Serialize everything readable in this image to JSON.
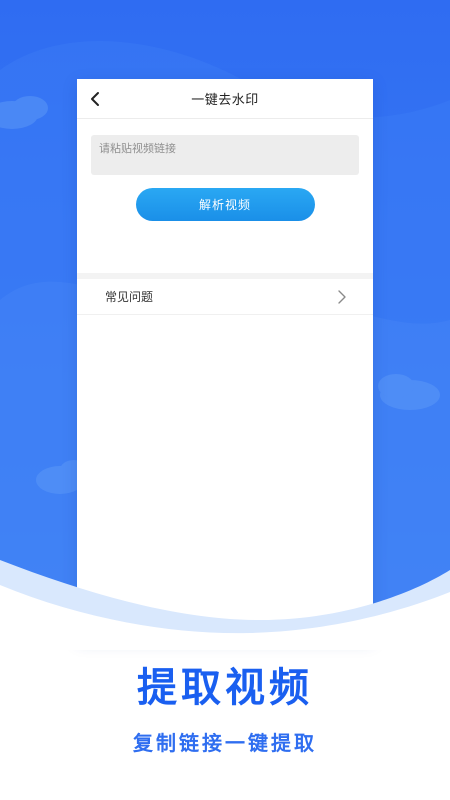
{
  "nav": {
    "back_icon": "chevron-left-icon",
    "title": "一键去水印"
  },
  "form": {
    "link_input_value": "",
    "link_input_placeholder": "请粘贴视频链接",
    "parse_button_label": "解析视频"
  },
  "faq": {
    "label": "常见问题",
    "chevron_icon": "chevron-right-icon"
  },
  "promo": {
    "headline": "提取视频",
    "subline": "复制链接一键提取"
  },
  "colors": {
    "hero_blue": "#2f6cf2",
    "accent_button": "#1e96ec",
    "headline_blue": "#1a5ff0"
  }
}
